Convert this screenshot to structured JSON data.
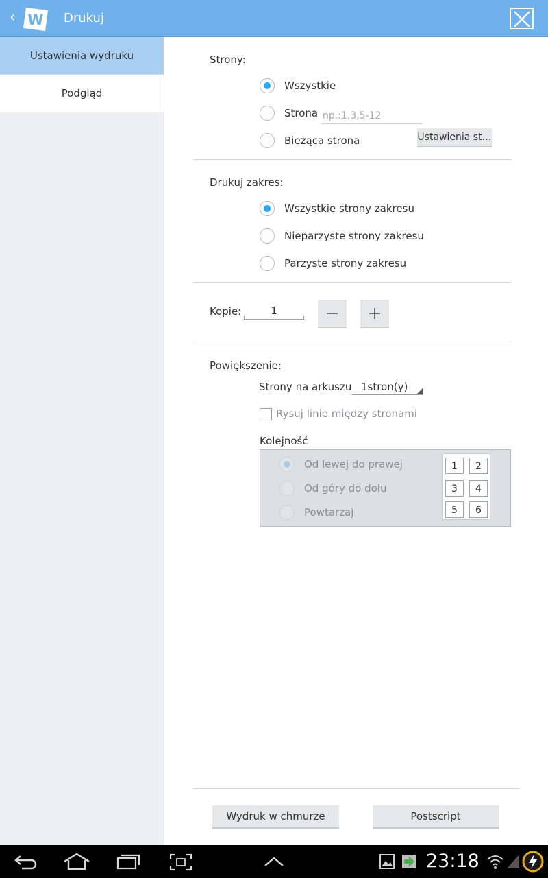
{
  "topbar": {
    "title": "Drukuj",
    "logo_letter": "W",
    "accent": "#6fb1ea"
  },
  "sidebar": {
    "items": [
      {
        "label": "Ustawienia wydruku",
        "active": true
      },
      {
        "label": "Podgląd",
        "active": false
      }
    ]
  },
  "pages": {
    "label": "Strony:",
    "options": [
      {
        "label": "Wszystkie",
        "selected": true
      },
      {
        "label": "Strona",
        "selected": false
      },
      {
        "label": "Bieżąca strona",
        "selected": false
      }
    ],
    "page_input_placeholder": "np.:1,3,5-12",
    "page_settings_button": "Ustawienia st…"
  },
  "range": {
    "label": "Drukuj zakres:",
    "options": [
      {
        "label": "Wszystkie strony zakresu",
        "selected": true
      },
      {
        "label": "Nieparzyste strony zakresu",
        "selected": false
      },
      {
        "label": "Parzyste strony zakresu",
        "selected": false
      }
    ]
  },
  "copies": {
    "label": "Kopie:",
    "value": "1"
  },
  "zoom": {
    "label": "Powiększenie:",
    "pages_per_sheet_label": "Strony na arkuszu",
    "pages_per_sheet_value": "1stron(y)",
    "draw_lines_label": "Rysuj linie między stronami",
    "draw_lines_checked": false,
    "order_label": "Kolejność",
    "order_options": [
      {
        "label": "Od lewej do prawej",
        "selected": true
      },
      {
        "label": "Od góry do dołu",
        "selected": false
      },
      {
        "label": "Powtarzaj",
        "selected": false
      }
    ],
    "grid_cells": [
      "1",
      "2",
      "3",
      "4",
      "5",
      "6"
    ]
  },
  "footer": {
    "cloud_print_button": "Wydruk w chmurze",
    "postscript_button": "Postscript"
  },
  "status": {
    "time": "23:18"
  },
  "icons": [
    "back-icon",
    "home-icon",
    "recent-apps-icon",
    "screenshot-icon",
    "up-arrow-icon",
    "gallery-icon",
    "download-icon",
    "wifi-icon",
    "signal-icon",
    "battery-icon",
    "close-icon"
  ]
}
